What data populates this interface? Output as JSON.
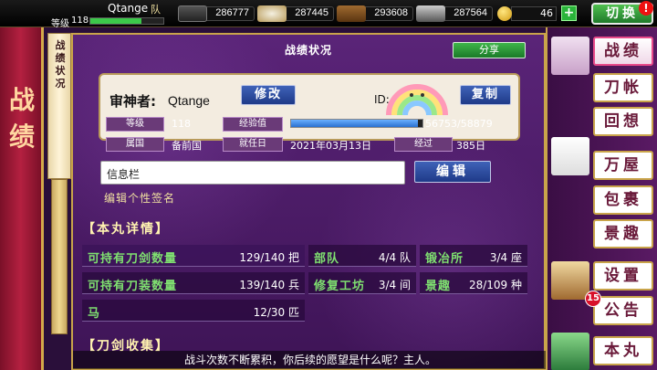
{
  "player": {
    "name": "Qtange",
    "team_tag": "队",
    "level_label": "等级",
    "level": "118",
    "level_fill": 0.7
  },
  "resources": [
    {
      "name": "charcoal",
      "value": "286777"
    },
    {
      "name": "rice",
      "value": "287445"
    },
    {
      "name": "wood",
      "value": "293608"
    },
    {
      "name": "steel",
      "value": "287564"
    }
  ],
  "coins": {
    "value": "46",
    "plus": "+"
  },
  "switch_btn": "切换",
  "alert": "!",
  "left": {
    "banner": "战绩",
    "scroll": "战绩状况"
  },
  "panel": {
    "title": "战绩状况",
    "share": "分享",
    "owner_label": "审神者:",
    "owner_name": "Qtange",
    "edit": "修改",
    "id_label": "ID:",
    "copy": "复制",
    "stats": {
      "level_tag": "等级",
      "level": "118",
      "exp_tag": "经验值",
      "exp": "56753/58879",
      "exp_fill": 0.964,
      "country_tag": "属国",
      "country": "备前国",
      "start_tag": "就任日",
      "start": "2021年03月13日",
      "elapsed_tag": "经过",
      "elapsed": "385日"
    },
    "info_value": "信息栏",
    "edit2": "编辑",
    "sig_hint": "编辑个性签名",
    "section1": "【本丸详情】",
    "rows": [
      {
        "k": "可持有刀剑数量",
        "v": "129/140 把"
      },
      {
        "k": "可持有刀装数量",
        "v": "139/140 兵"
      },
      {
        "k": "马",
        "v": "12/30 匹"
      }
    ],
    "rows_mid": [
      {
        "k": "部队",
        "v": "4/4 队"
      },
      {
        "k": "修复工坊",
        "v": "3/4 间"
      }
    ],
    "rows_right": [
      {
        "k": "锻冶所",
        "v": "3/4 座"
      },
      {
        "k": "景趣",
        "v": "28/109 种"
      }
    ],
    "section2": "【刀剑收集】",
    "bottom_msg": "战斗次数不断累积，你后续的愿望是什么呢？主人。"
  },
  "menu": {
    "senseki": "战绩",
    "katana": "刀帐",
    "kaiso": "回想",
    "manya": "万屋",
    "tsutsumi": "包裹",
    "keishu": "景趣",
    "settei": "设置",
    "notice": "公告",
    "notice_badge": "15",
    "honmaru": "本丸"
  }
}
